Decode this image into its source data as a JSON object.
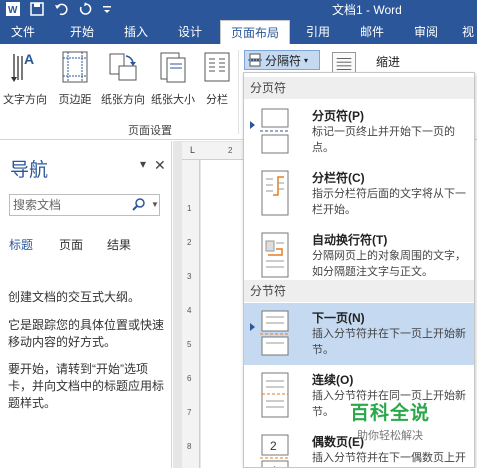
{
  "title_bar": {
    "doc_title": "文档1 - Word",
    "qat_icons": [
      "word-logo-icon",
      "save-icon",
      "undo-icon",
      "redo-icon"
    ]
  },
  "tabs": {
    "file": "文件",
    "home": "开始",
    "insert": "插入",
    "design": "设计",
    "layout": "页面布局",
    "references": "引用",
    "mailings": "邮件",
    "review": "审阅",
    "view": "视"
  },
  "ribbon": {
    "text_direction": "文字方向",
    "margins": "页边距",
    "orientation": "纸张方向",
    "size": "纸张大小",
    "columns": "分栏",
    "group_label": "页面设置",
    "breaks": "分隔符",
    "indent": "缩进"
  },
  "nav": {
    "title": "导航",
    "search_placeholder": "搜索文档",
    "tabs": [
      "标题",
      "页面",
      "结果"
    ],
    "p1": "创建文档的交互式大纲。",
    "p2": "它是跟踪您的具体位置或快速移动内容的好方式。",
    "p3": "要开始，请转到“开始”选项卡，并向文档中的标题应用标题样式。"
  },
  "ruler": {
    "h_marks": [
      "L",
      "2"
    ],
    "v_marks": [
      "1",
      "2",
      "3",
      "4",
      "5",
      "6",
      "7",
      "8"
    ]
  },
  "menu": {
    "section1": "分页符",
    "section2": "分节符",
    "items": [
      {
        "name": "分页符(P)",
        "desc": "标记一页终止并开始下一页的点。"
      },
      {
        "name": "分栏符(C)",
        "desc": "指示分栏符后面的文字将从下一栏开始。"
      },
      {
        "name": "自动换行符(T)",
        "desc": "分隔网页上的对象周围的文字，如分隔题注文字与正文。"
      },
      {
        "name": "下一页(N)",
        "desc": "插入分节符并在下一页上开始新节。"
      },
      {
        "name": "连续(O)",
        "desc": "插入分节符并在同一页上开始新节。"
      },
      {
        "name": "偶数页(E)",
        "desc": "插入分节符并在下一偶数页上开始新节。"
      }
    ]
  },
  "watermark": {
    "title": "百科全说",
    "subtitle": "助你轻松解决"
  },
  "colors": {
    "accent": "#2b579a",
    "highlight": "#c5d9f1",
    "watermark": "#2aa84a"
  }
}
